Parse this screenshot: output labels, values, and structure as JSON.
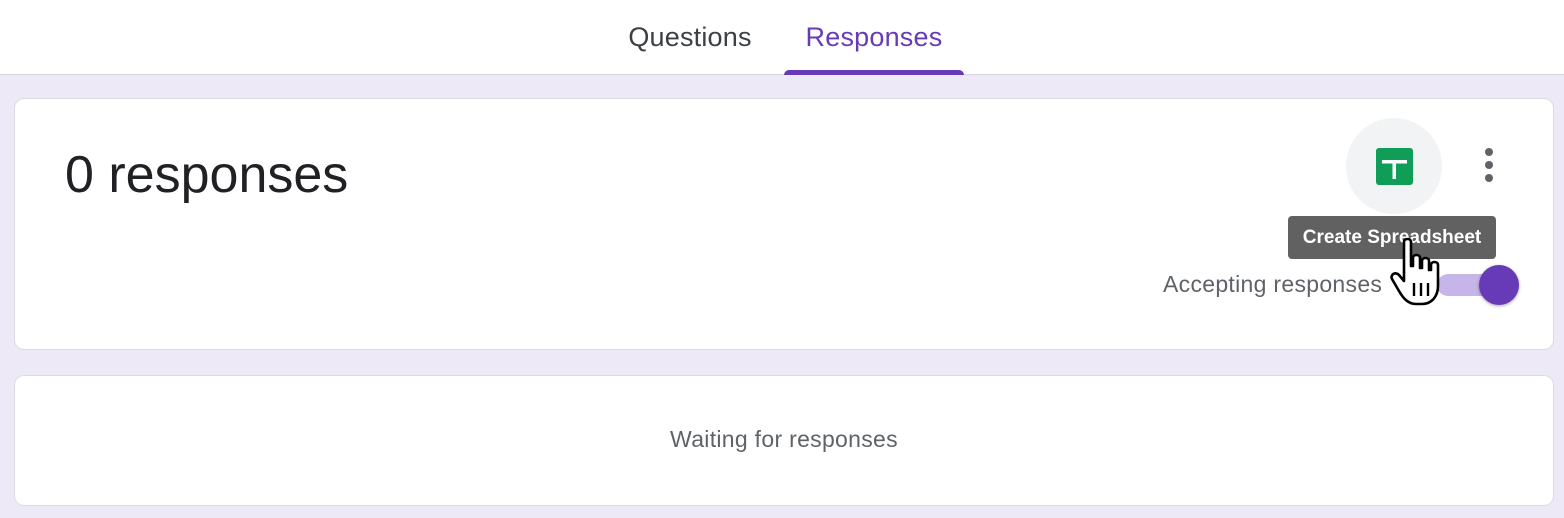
{
  "tabs": {
    "questions_label": "Questions",
    "responses_label": "Responses",
    "active": "Responses"
  },
  "summary": {
    "count_label": "0 responses",
    "sheets_tooltip": "Create Spreadsheet",
    "accepting_label": "Accepting responses",
    "accepting_on": true
  },
  "waiting": {
    "message": "Waiting for responses"
  },
  "icons": {
    "sheets": "google-sheets-icon",
    "more": "more-vert-icon",
    "cursor": "hand-pointer-cursor"
  },
  "colors": {
    "accent": "#673ab7",
    "sheets_green": "#0f9d58",
    "background": "#ede9f7"
  }
}
